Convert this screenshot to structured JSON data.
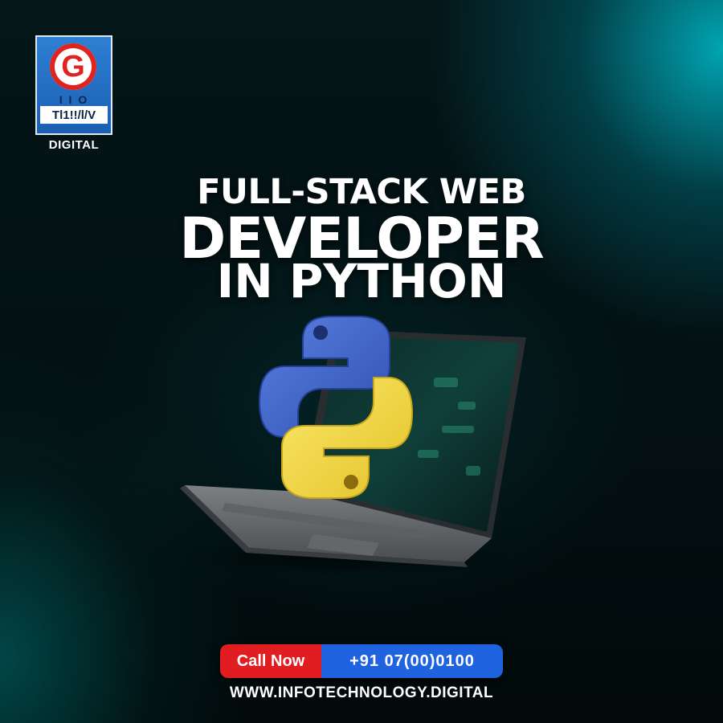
{
  "logo": {
    "letter": "G",
    "line1": "I I O",
    "line2": "Tl1!!/l/V",
    "caption": "DIGITAL"
  },
  "headline": {
    "line1": "FULL-STACK WEB",
    "line2": "DEVELOPER",
    "line3": "IN PYTHON"
  },
  "illustration": {
    "icon": "python-logo-icon",
    "device": "laptop-icon",
    "colors": {
      "python_blue": "#3f63c8",
      "python_yellow": "#f2d94a",
      "laptop_body": "#6f7275"
    }
  },
  "cta": {
    "call_label": "Call Now",
    "phone": "+91 07(00)0100",
    "website": "WWW.INFOTECHNOLOGY.DIGITAL",
    "colors": {
      "call_bg": "#e11d22",
      "phone_bg": "#1f63e0"
    }
  }
}
